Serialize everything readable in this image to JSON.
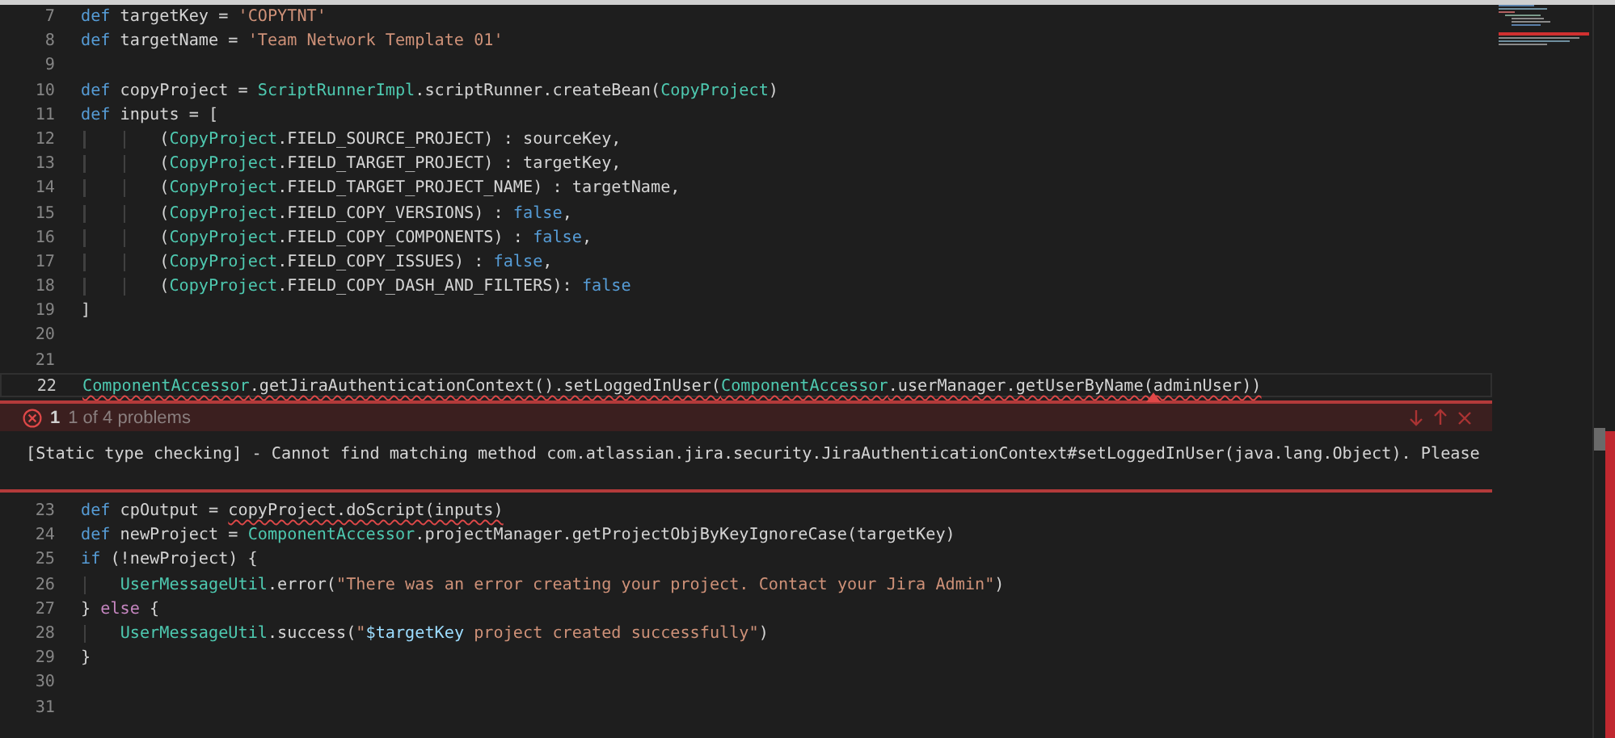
{
  "editor": {
    "lines_before": [
      {
        "number": "7",
        "current": false,
        "tokens": [
          {
            "kind": "keyword",
            "text": "def",
            "squiggly": false
          },
          {
            "kind": "plain",
            "text": " targetKey = ",
            "squiggly": false
          },
          {
            "kind": "string",
            "text": "'COPYTNT'",
            "squiggly": false
          }
        ]
      },
      {
        "number": "8",
        "current": false,
        "tokens": [
          {
            "kind": "keyword",
            "text": "def",
            "squiggly": false
          },
          {
            "kind": "plain",
            "text": " targetName = ",
            "squiggly": false
          },
          {
            "kind": "string",
            "text": "'Team Network Template 01'",
            "squiggly": false
          }
        ]
      },
      {
        "number": "9",
        "current": false
      },
      {
        "number": "10",
        "current": false,
        "tokens": [
          {
            "kind": "keyword",
            "text": "def",
            "squiggly": false
          },
          {
            "kind": "plain",
            "text": " copyProject = ",
            "squiggly": false
          },
          {
            "kind": "type",
            "text": "ScriptRunnerImpl",
            "squiggly": false
          },
          {
            "kind": "plain",
            "text": ".scriptRunner.createBean(",
            "squiggly": false
          },
          {
            "kind": "type",
            "text": "CopyProject",
            "squiggly": false
          },
          {
            "kind": "plain",
            "text": ")",
            "squiggly": false
          }
        ]
      },
      {
        "number": "11",
        "current": false,
        "tokens": [
          {
            "kind": "keyword",
            "text": "def",
            "squiggly": false
          },
          {
            "kind": "plain",
            "text": " inputs = [",
            "squiggly": false
          }
        ]
      },
      {
        "number": "12",
        "current": false,
        "tokens": [
          {
            "kind": "plain",
            "text": "        (",
            "squiggly": false
          },
          {
            "kind": "type",
            "text": "CopyProject",
            "squiggly": false
          },
          {
            "kind": "plain",
            "text": ".FIELD_SOURCE_PROJECT) : sourceKey,",
            "squiggly": false
          }
        ]
      },
      {
        "number": "13",
        "current": false,
        "tokens": [
          {
            "kind": "plain",
            "text": "        (",
            "squiggly": false
          },
          {
            "kind": "type",
            "text": "CopyProject",
            "squiggly": false
          },
          {
            "kind": "plain",
            "text": ".FIELD_TARGET_PROJECT) : targetKey,",
            "squiggly": false
          }
        ]
      },
      {
        "number": "14",
        "current": false,
        "tokens": [
          {
            "kind": "plain",
            "text": "        (",
            "squiggly": false
          },
          {
            "kind": "type",
            "text": "CopyProject",
            "squiggly": false
          },
          {
            "kind": "plain",
            "text": ".FIELD_TARGET_PROJECT_NAME) : targetName,",
            "squiggly": false
          }
        ]
      },
      {
        "number": "15",
        "current": false,
        "tokens": [
          {
            "kind": "plain",
            "text": "        (",
            "squiggly": false
          },
          {
            "kind": "type",
            "text": "CopyProject",
            "squiggly": false
          },
          {
            "kind": "plain",
            "text": ".FIELD_COPY_VERSIONS) : ",
            "squiggly": false
          },
          {
            "kind": "keyword",
            "text": "false",
            "squiggly": false
          },
          {
            "kind": "plain",
            "text": ",",
            "squiggly": false
          }
        ]
      },
      {
        "number": "16",
        "current": false,
        "tokens": [
          {
            "kind": "plain",
            "text": "        (",
            "squiggly": false
          },
          {
            "kind": "type",
            "text": "CopyProject",
            "squiggly": false
          },
          {
            "kind": "plain",
            "text": ".FIELD_COPY_COMPONENTS) : ",
            "squiggly": false
          },
          {
            "kind": "keyword",
            "text": "false",
            "squiggly": false
          },
          {
            "kind": "plain",
            "text": ",",
            "squiggly": false
          }
        ]
      },
      {
        "number": "17",
        "current": false,
        "tokens": [
          {
            "kind": "plain",
            "text": "        (",
            "squiggly": false
          },
          {
            "kind": "type",
            "text": "CopyProject",
            "squiggly": false
          },
          {
            "kind": "plain",
            "text": ".FIELD_COPY_ISSUES) : ",
            "squiggly": false
          },
          {
            "kind": "keyword",
            "text": "false",
            "squiggly": false
          },
          {
            "kind": "plain",
            "text": ",",
            "squiggly": false
          }
        ]
      },
      {
        "number": "18",
        "current": false,
        "tokens": [
          {
            "kind": "plain",
            "text": "        (",
            "squiggly": false
          },
          {
            "kind": "type",
            "text": "CopyProject",
            "squiggly": false
          },
          {
            "kind": "plain",
            "text": ".FIELD_COPY_DASH_AND_FILTERS): ",
            "squiggly": false
          },
          {
            "kind": "keyword",
            "text": "false",
            "squiggly": false
          }
        ]
      },
      {
        "number": "19",
        "current": false,
        "tokens": [
          {
            "kind": "plain",
            "text": "]",
            "squiggly": false
          }
        ]
      },
      {
        "number": "20",
        "current": false
      },
      {
        "number": "21",
        "current": false
      },
      {
        "number": "22",
        "current": true,
        "tokens": [
          {
            "kind": "type",
            "text": "ComponentAccessor",
            "squiggly": true
          },
          {
            "kind": "plain",
            "text": ".getJiraAuthenticationContext().setLoggedInUser(",
            "squiggly": true
          },
          {
            "kind": "type",
            "text": "ComponentAccessor",
            "squiggly": true
          },
          {
            "kind": "plain",
            "text": ".userManager.getUserByName(adminUser))",
            "squiggly": true
          }
        ]
      }
    ],
    "problem_peek": {
      "count": "1",
      "summary": "1 of 4 problems",
      "message": "[Static type checking] - Cannot find matching method com.atlassian.jira.security.JiraAuthenticationContext#setLoggedInUser(java.lang.Object). Please"
    },
    "lines_after": [
      {
        "number": "23",
        "current": false,
        "tokens": [
          {
            "kind": "keyword",
            "text": "def",
            "squiggly": false
          },
          {
            "kind": "plain",
            "text": " cpOutput = ",
            "squiggly": false
          },
          {
            "kind": "plain",
            "text": "copyProject.doScript(inputs)",
            "squiggly": true
          }
        ]
      },
      {
        "number": "24",
        "current": false,
        "tokens": [
          {
            "kind": "keyword",
            "text": "def",
            "squiggly": false
          },
          {
            "kind": "plain",
            "text": " newProject = ",
            "squiggly": false
          },
          {
            "kind": "type",
            "text": "ComponentAccessor",
            "squiggly": false
          },
          {
            "kind": "plain",
            "text": ".projectManager.getProjectObjByKeyIgnoreCase(targetKey)",
            "squiggly": false
          }
        ]
      },
      {
        "number": "25",
        "current": false,
        "tokens": [
          {
            "kind": "keyword",
            "text": "if",
            "squiggly": false
          },
          {
            "kind": "plain",
            "text": " (!newProject) {",
            "squiggly": false
          }
        ]
      },
      {
        "number": "26",
        "current": false,
        "tokens": [
          {
            "kind": "type",
            "text": "    UserMessageUtil",
            "squiggly": false
          },
          {
            "kind": "plain",
            "text": ".error(",
            "squiggly": false
          },
          {
            "kind": "string",
            "text": "\"There was an error creating your project. Contact your Jira Admin\"",
            "squiggly": false
          },
          {
            "kind": "plain",
            "text": ")",
            "squiggly": false
          }
        ]
      },
      {
        "number": "27",
        "current": false,
        "tokens": [
          {
            "kind": "plain",
            "text": "} ",
            "squiggly": false
          },
          {
            "kind": "control",
            "text": "else",
            "squiggly": false
          },
          {
            "kind": "plain",
            "text": " {",
            "squiggly": false
          }
        ]
      },
      {
        "number": "28",
        "current": false,
        "tokens": [
          {
            "kind": "type",
            "text": "    UserMessageUtil",
            "squiggly": false
          },
          {
            "kind": "plain",
            "text": ".success(",
            "squiggly": false
          },
          {
            "kind": "string",
            "text": "\"",
            "squiggly": false
          },
          {
            "kind": "variable",
            "text": "$targetKey",
            "squiggly": false
          },
          {
            "kind": "string",
            "text": " project created successfully\"",
            "squiggly": false
          },
          {
            "kind": "plain",
            "text": ")",
            "squiggly": false
          }
        ]
      },
      {
        "number": "29",
        "current": false,
        "tokens": [
          {
            "kind": "plain",
            "text": "}",
            "squiggly": false
          }
        ]
      },
      {
        "number": "30",
        "current": false
      },
      {
        "number": "31",
        "current": false
      }
    ]
  }
}
